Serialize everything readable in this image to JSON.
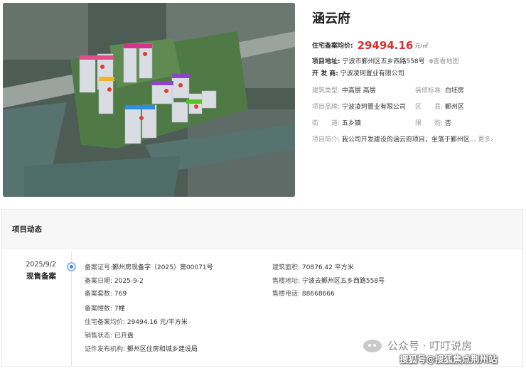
{
  "project": {
    "name": "涵云府",
    "price_label": "住宅备案均价:",
    "price_value": "29494.16",
    "price_unit": "元/㎡",
    "address_label": "项目地址:",
    "address_value": "宁波市鄞州区五乡西路558号",
    "map_link": "查看地图",
    "developer_label": "开 发 商:",
    "developer_value": "宁波凌珂置业有限公司",
    "building_type_label": "建筑类型:",
    "building_type_value": "中高层 高层",
    "decoration_label": "装修标准:",
    "decoration_value": "白坯房",
    "brand_label": "项目品牌:",
    "brand_value": "宁波凌珂置业有限公司",
    "district_label": "区　　县:",
    "district_value": "鄞州区",
    "street_label": "街　　道:",
    "street_value": "五乡镇",
    "limit_label": "限　　购:",
    "limit_value": "否",
    "intro_label": "项目简介:",
    "intro_value": "我公司开发建设的涵云府项目，坐落于鄞州区...",
    "more_link": "更多›"
  },
  "section": {
    "title": "项目动态"
  },
  "timeline": {
    "date": "2025/9/2",
    "kind": "现售备案",
    "left_fields": [
      {
        "k": "备案证号:",
        "v": "鄞州房现备字（2025）第00071号"
      },
      {
        "k": "备案日期:",
        "v": "2025-9-2"
      },
      {
        "k": "备案套数:",
        "v": "769"
      },
      {
        "k": "备案幢数:",
        "v": "7幢"
      },
      {
        "k": "住宅备案均价:",
        "v": "29494.16 元/平方米"
      },
      {
        "k": "销售状态:",
        "v": "已开盘"
      },
      {
        "k": "证件发布机构:",
        "v": "鄞州区住房和城乡建设局"
      }
    ],
    "right_fields": [
      {
        "k": "建筑面积:",
        "v": "70876.42 平方米"
      },
      {
        "k": "售楼地址:",
        "v": "宁波去鄞州区五乡西路558号"
      },
      {
        "k": "售楼电话:",
        "v": "88668666"
      }
    ]
  },
  "watermarks": {
    "account": "公众号 · 叮叮说房",
    "source": "搜狐号@搜狐焦点荆州站"
  },
  "colors": {
    "price_red": "#d9302c",
    "dot_blue": "#3f86d9",
    "building_labels": [
      "#e84b8a",
      "#d6338c",
      "#8e44c9",
      "#8e44c9",
      "#f0b429",
      "#2e8de0",
      "#52c41a"
    ]
  }
}
